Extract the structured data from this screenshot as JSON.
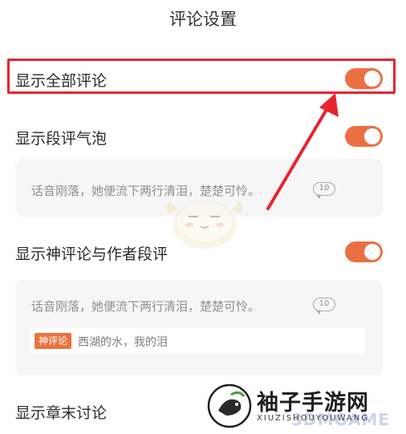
{
  "header": {
    "title": "评论设置"
  },
  "settings": [
    {
      "label": "显示全部评论",
      "enabled": true
    },
    {
      "label": "显示段评气泡",
      "enabled": true
    },
    {
      "label": "显示神评论与作者段评",
      "enabled": true
    },
    {
      "label": "显示章末讨论"
    }
  ],
  "preview_bubble": {
    "text": "话音刚落，她便流下两行清泪，楚楚可怜。",
    "count": "10"
  },
  "preview_god": {
    "text": "话音刚落，她便流下两行清泪，楚楚可怜。",
    "count": "10",
    "tag": "神评论",
    "comment": "西湖的水，我的泪"
  },
  "watermark": {
    "name": "袖子手游网",
    "domain": "XIUZISHOUYOUWANG",
    "overlay": "3DMGAME"
  },
  "colors": {
    "toggle_on": "#ea7044",
    "highlight": "#e8232e",
    "tag": "#e9733f",
    "preview_bg": "#f6f6f6"
  },
  "icons": [
    "toggle-switch",
    "comment-count-bubble",
    "red-arrow-annotation",
    "mascot-icon",
    "watermark-logo"
  ]
}
